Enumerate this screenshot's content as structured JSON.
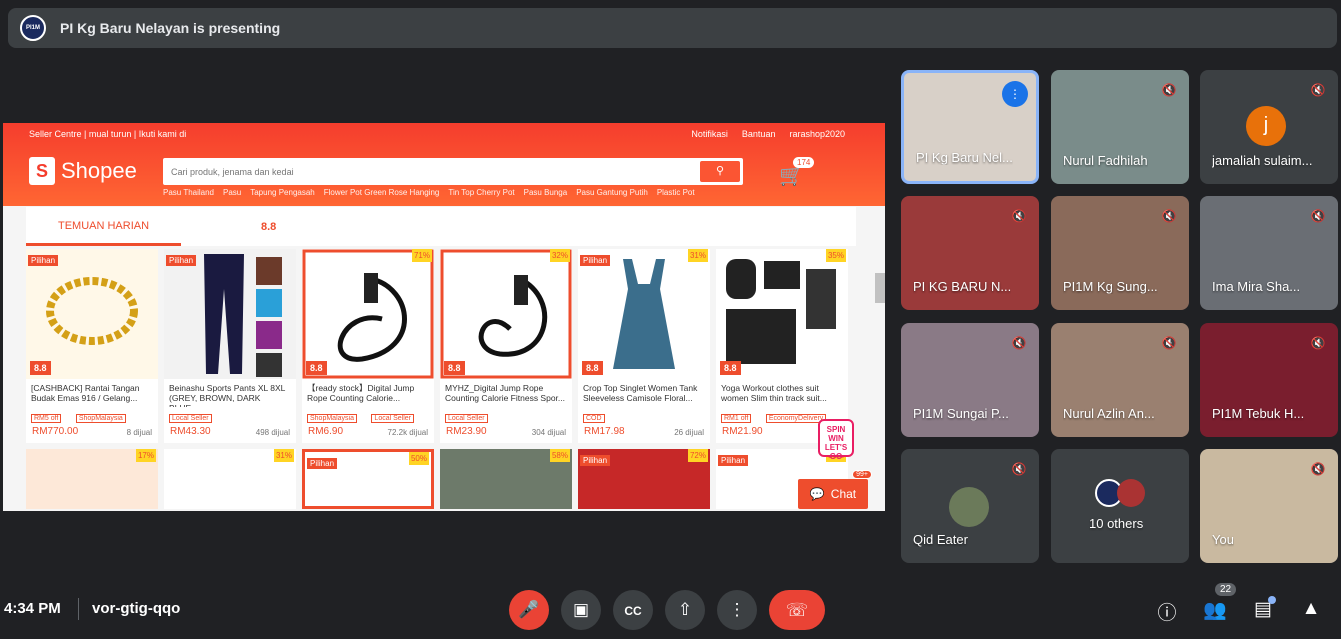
{
  "presenter_bar": {
    "avatar_text": "PI1M",
    "title": "PI Kg Baru Nelayan is presenting"
  },
  "shopee": {
    "top_left": "Seller Centre  |  mual turun  |  Ikuti kami di",
    "top_right": {
      "notif": "Notifikasi",
      "help": "Bantuan",
      "user": "rarashop2020"
    },
    "logo": "Shopee",
    "search_placeholder": "Cari produk, jenama dan kedai",
    "cart_count": "174",
    "hints": [
      "Pasu Thailand",
      "Pasu",
      "Tapung Pengasah",
      "Flower Pot Green Rose Hanging",
      "Tin Top Cherry Pot",
      "Pasu Bunga",
      "Pasu Gantung Putih",
      "Plastic Pot"
    ],
    "tab_active": "TEMUAN HARIAN",
    "tab_88": "8.8",
    "products": [
      {
        "pilihan": "Pilihan",
        "disc": "",
        "name": "[CASHBACK] Rantai Tangan Budak Emas 916 / Gelang...",
        "tag": "RM5 off",
        "tag2": "ShopMalaysia",
        "price": "RM770.00",
        "sold": "8 dijual"
      },
      {
        "pilihan": "Pilihan",
        "disc": "",
        "name": "Beinashu Sports Pants XL 8XL (GREY, BROWN, DARK BLUE,...",
        "tag": "Local Seller",
        "tag2": "",
        "price": "RM43.30",
        "sold": "498 dijual"
      },
      {
        "pilihan": "",
        "disc": "71%",
        "name": "【ready stock】Digital Jump Rope Counting Calorie...",
        "tag": "ShopMalaysia",
        "tag2": "Local Seller",
        "price": "RM6.90",
        "sold": "72.2k dijual"
      },
      {
        "pilihan": "",
        "disc": "32%",
        "name": "MYHZ_Digital Jump Rope Counting Calorie Fitness Spor...",
        "tag": "Local Seller",
        "tag2": "",
        "price": "RM23.90",
        "sold": "304 dijual"
      },
      {
        "pilihan": "Pilihan",
        "disc": "31%",
        "name": "Crop Top Singlet Women Tank Sleeveless Camisole Floral...",
        "tag": "COD",
        "tag2": "",
        "price": "RM17.98",
        "sold": "26 dijual"
      },
      {
        "pilihan": "",
        "disc": "35%",
        "name": "Yoga Workout clothes suit women Slim thin track suit...",
        "tag": "RM1 off",
        "tag2": "EconomyDelivery",
        "price": "RM21.90",
        "sold": ""
      }
    ],
    "row2_discounts": [
      "17%",
      "31%",
      "50%",
      "58%",
      "72%",
      "56%"
    ],
    "row2_pilihan": [
      "",
      "",
      "Pilihan",
      "",
      "Pilihan",
      "Pilihan"
    ],
    "chat": "Chat",
    "chat_count": "99+",
    "spin": "SPIN WIN LET'S GO"
  },
  "participants": [
    {
      "name": "PI Kg Baru Nel...",
      "active": true
    },
    {
      "name": "Nurul Fadhilah"
    },
    {
      "name": "jamaliah sulaim...",
      "initial": "j"
    },
    {
      "name": "PI KG BARU N..."
    },
    {
      "name": "PI1M Kg Sung..."
    },
    {
      "name": "Ima Mira Sha..."
    },
    {
      "name": "PI1M Sungai P..."
    },
    {
      "name": "Nurul Azlin An..."
    },
    {
      "name": "PI1M Tebuk H..."
    },
    {
      "name": "Qid Eater"
    },
    {
      "name": "10 others"
    },
    {
      "name": "You"
    }
  ],
  "bottom": {
    "time": "4:34 PM",
    "code": "vor-gtig-qqo",
    "people_count": "22"
  }
}
